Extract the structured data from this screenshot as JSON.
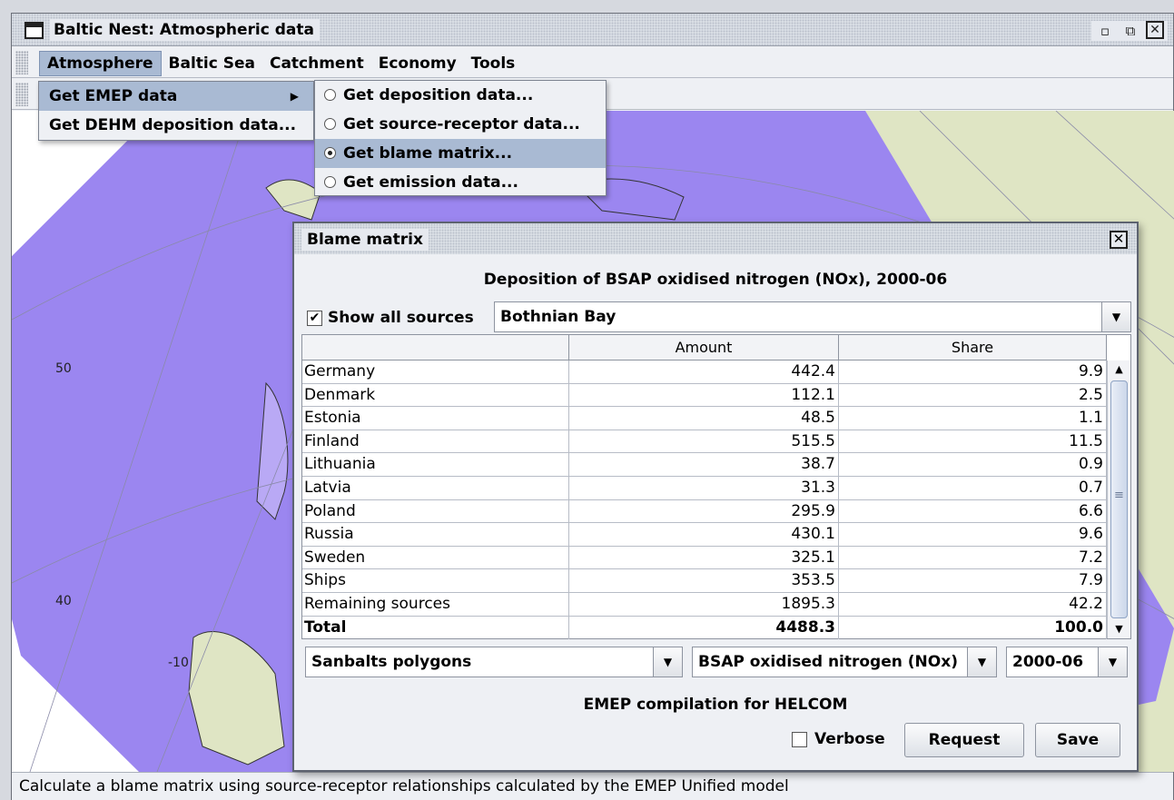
{
  "window": {
    "title": "Baltic Nest: Atmospheric data"
  },
  "menubar": {
    "items": [
      "Atmosphere",
      "Baltic Sea",
      "Catchment",
      "Economy",
      "Tools"
    ]
  },
  "atmosphere_menu": {
    "items": [
      {
        "label": "Get EMEP data",
        "mnemonic": "e",
        "has_submenu": true
      },
      {
        "label": "Get DEHM deposition data..."
      }
    ]
  },
  "emep_submenu": {
    "items": [
      {
        "label": "Get deposition data...",
        "selected": false
      },
      {
        "label": "Get source-receptor data...",
        "selected": false
      },
      {
        "label": "Get blame matrix...",
        "selected": true
      },
      {
        "label": "Get emission data...",
        "selected": false
      }
    ]
  },
  "map": {
    "labels": [
      "50",
      "40",
      "-10"
    ],
    "colors": {
      "sea_overlay": "#9b86f0",
      "land": "#dfe5c4",
      "background": "#ffffff"
    }
  },
  "dialog": {
    "title": "Blame matrix",
    "heading": "Deposition of BSAP oxidised nitrogen (NOx), 2000-06",
    "show_all_sources": {
      "label": "Show all sources",
      "checked": true
    },
    "region": "Bothnian Bay",
    "table": {
      "headers": [
        "",
        "Amount",
        "Share"
      ],
      "rows": [
        [
          "Germany",
          "442.4",
          "9.9"
        ],
        [
          "Denmark",
          "112.1",
          "2.5"
        ],
        [
          "Estonia",
          "48.5",
          "1.1"
        ],
        [
          "Finland",
          "515.5",
          "11.5"
        ],
        [
          "Lithuania",
          "38.7",
          "0.9"
        ],
        [
          "Latvia",
          "31.3",
          "0.7"
        ],
        [
          "Poland",
          "295.9",
          "6.6"
        ],
        [
          "Russia",
          "430.1",
          "9.6"
        ],
        [
          "Sweden",
          "325.1",
          "7.2"
        ],
        [
          "Ships",
          "353.5",
          "7.9"
        ],
        [
          "Remaining sources",
          "1895.3",
          "42.2"
        ]
      ],
      "total": [
        "Total",
        "4488.3",
        "100.0"
      ]
    },
    "polygons": "Sanbalts polygons",
    "substance": "BSAP oxidised nitrogen (NOx)",
    "period": "2000-06",
    "compilation": "EMEP compilation for HELCOM",
    "verbose": {
      "label": "Verbose",
      "checked": false
    },
    "request_label": "Request",
    "save_label": "Save"
  },
  "status": {
    "text": "Calculate a blame matrix using source-receptor relationships calculated by the EMEP Unified model"
  }
}
